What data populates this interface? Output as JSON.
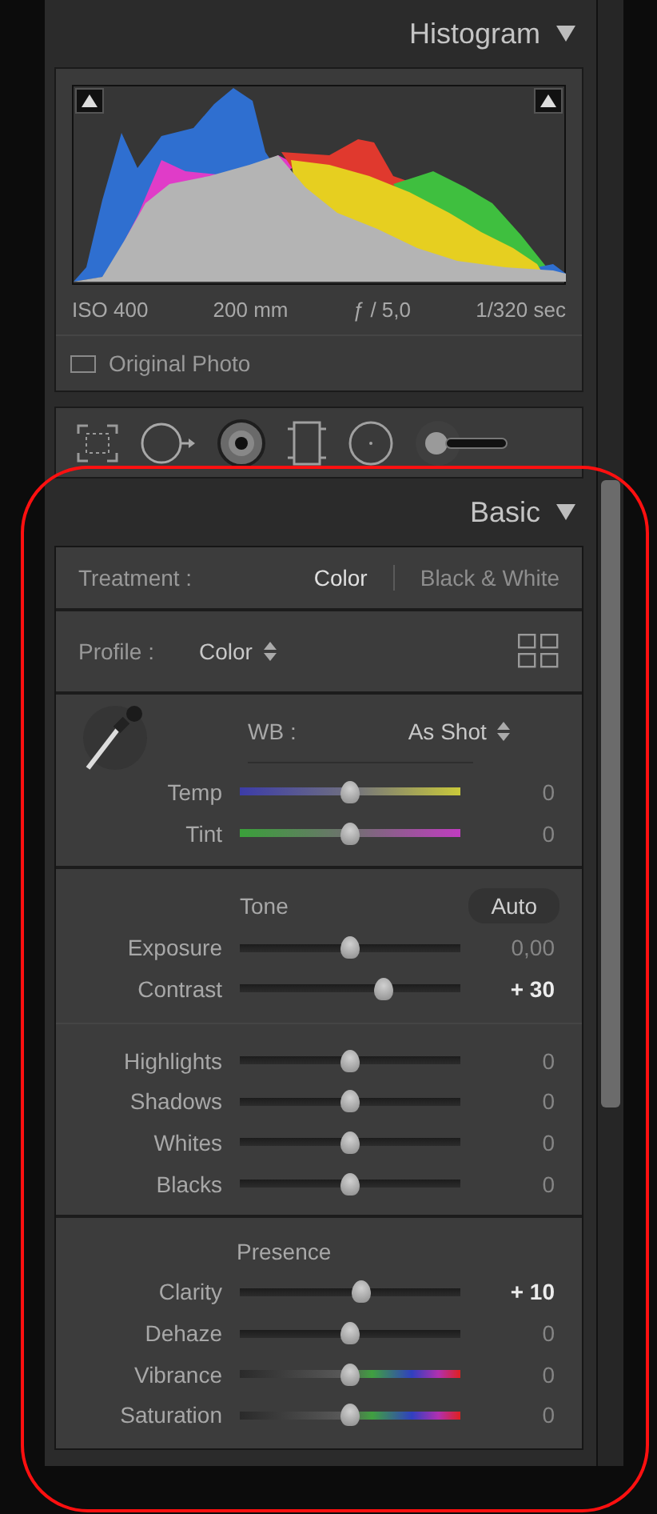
{
  "histogram": {
    "title": "Histogram",
    "exif": [
      "ISO 400",
      "200 mm",
      "ƒ / 5,0",
      "1/320 sec"
    ],
    "original_photo": {
      "label": "Original Photo",
      "checked": false
    }
  },
  "basic": {
    "title": "Basic",
    "treatment": {
      "label": "Treatment :",
      "options": [
        {
          "label": "Color",
          "selected": true
        },
        {
          "label": "Black & White",
          "selected": false
        }
      ]
    },
    "profile": {
      "label": "Profile :",
      "value": "Color"
    },
    "wb": {
      "label": "WB :",
      "value": "As Shot",
      "sliders": [
        {
          "label": "Temp",
          "kind": "temp",
          "level": 0.5,
          "value": "0",
          "changed": false
        },
        {
          "label": "Tint",
          "kind": "tint",
          "level": 0.5,
          "value": "0",
          "changed": false
        }
      ]
    },
    "tone": {
      "title": "Tone",
      "button": "Auto",
      "sliders": [
        {
          "label": "Exposure",
          "kind": "plain",
          "level": 0.5,
          "value": "0,00",
          "changed": false
        },
        {
          "label": "Contrast",
          "kind": "plain",
          "level": 0.65,
          "value": "+ 30",
          "changed": true
        }
      ]
    },
    "tone_details": {
      "sliders": [
        {
          "label": "Highlights",
          "kind": "plain",
          "level": 0.5,
          "value": "0",
          "changed": false
        },
        {
          "label": "Shadows",
          "kind": "plain",
          "level": 0.5,
          "value": "0",
          "changed": false
        },
        {
          "label": "Whites",
          "kind": "plain",
          "level": 0.5,
          "value": "0",
          "changed": false
        },
        {
          "label": "Blacks",
          "kind": "plain",
          "level": 0.5,
          "value": "0",
          "changed": false
        }
      ]
    },
    "presence": {
      "title": "Presence",
      "sliders": [
        {
          "label": "Clarity",
          "kind": "plain",
          "level": 0.55,
          "value": "+ 10",
          "changed": true
        },
        {
          "label": "Dehaze",
          "kind": "plain",
          "level": 0.5,
          "value": "0",
          "changed": false
        },
        {
          "label": "Vibrance",
          "kind": "vibrance",
          "level": 0.5,
          "value": "0",
          "changed": false
        },
        {
          "label": "Saturation",
          "kind": "saturation",
          "level": 0.5,
          "value": "0",
          "changed": false
        }
      ]
    }
  }
}
